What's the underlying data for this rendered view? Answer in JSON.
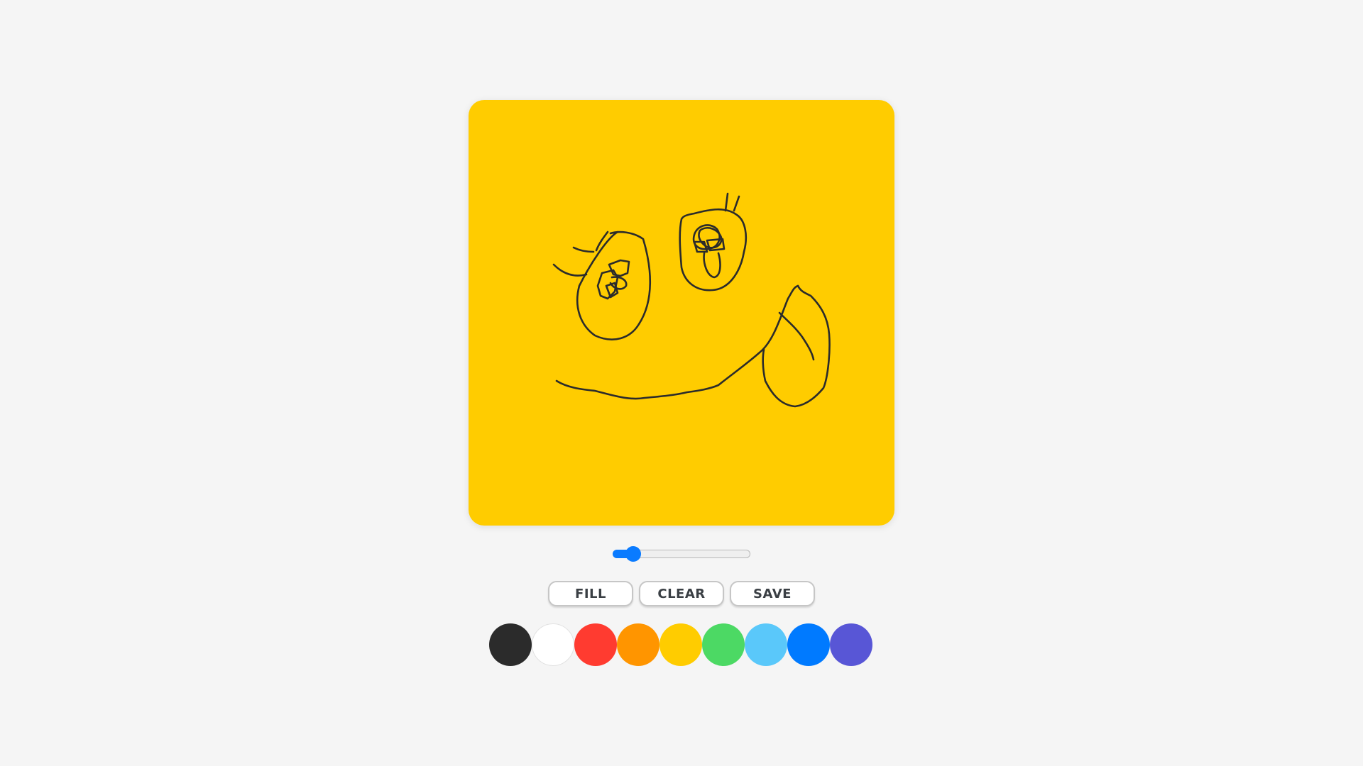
{
  "canvas": {
    "background_color": "#ffcc00",
    "stroke_color": "#2b2b2b"
  },
  "brush_size": {
    "value_fraction": 0.15,
    "accent_color": "#0a7bff"
  },
  "toolbar": {
    "fill_label": "FILL",
    "clear_label": "CLEAR",
    "save_label": "SAVE"
  },
  "palette": [
    {
      "name": "black",
      "color": "#2b2b2b"
    },
    {
      "name": "white",
      "color": "#ffffff"
    },
    {
      "name": "red",
      "color": "#ff3b30"
    },
    {
      "name": "orange",
      "color": "#ff9500"
    },
    {
      "name": "yellow",
      "color": "#ffcc00"
    },
    {
      "name": "green",
      "color": "#4cd964"
    },
    {
      "name": "light-blue",
      "color": "#5ac8fa"
    },
    {
      "name": "blue",
      "color": "#007aff"
    },
    {
      "name": "purple",
      "color": "#5856d6"
    }
  ]
}
